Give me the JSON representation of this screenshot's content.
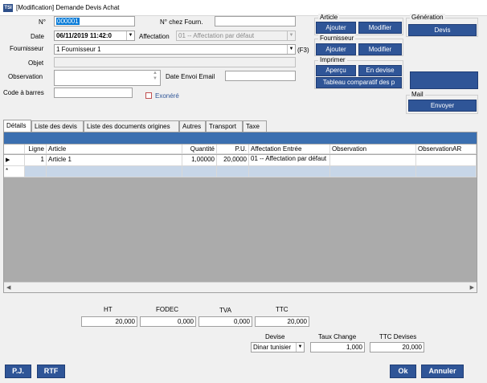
{
  "window": {
    "title": "[Modification] Demande Devis Achat",
    "app_icon_text": "TSI"
  },
  "form": {
    "no_label": "N°",
    "no_value": "000001",
    "no_fourn_label": "N° chez Fourn.",
    "no_fourn_value": "",
    "date_label": "Date",
    "date_value": "06/11/2019 11:42:0",
    "affectation_label": "Affectation",
    "affectation_value": "01 -- Affectation par défaut",
    "fournisseur_label": "Fournisseur",
    "fournisseur_value": "1 Fournisseur 1",
    "fournisseur_shortcut": "(F3)",
    "objet_label": "Objet",
    "objet_value": "",
    "observation_label": "Observation",
    "observation_value": "",
    "date_envoi_label": "Date Envoi Email",
    "date_envoi_value": "",
    "code_barres_label": "Code à barres",
    "code_barres_value": "",
    "exonere_label": "Exonéré"
  },
  "groups": {
    "article": {
      "label": "Article",
      "ajouter": "Ajouter",
      "modifier": "Modifier"
    },
    "fournisseur": {
      "label": "Fournisseur",
      "ajouter": "Ajouter",
      "modifier": "Modifier"
    },
    "imprimer": {
      "label": "Imprimer",
      "apercu": "Aperçu",
      "en_devise": "En devise",
      "tableau": "Tableau comparatif des p"
    },
    "generation": {
      "label": "Génération",
      "devis": "Devis"
    },
    "mail": {
      "label": "Mail",
      "envoyer": "Envoyer"
    }
  },
  "tabs": [
    "Détails",
    "Liste des devis",
    "Liste des documents origines",
    "Autres",
    "Transport",
    "Taxe"
  ],
  "grid": {
    "columns": [
      "Ligne",
      "Article",
      "Quantité",
      "P.U.",
      "Affectation Entrée",
      "Observation",
      "ObservationAR"
    ],
    "rows": [
      {
        "ligne": "1",
        "article": "Article 1",
        "quantite": "1,00000",
        "pu": "20,0000",
        "affectation": "01 -- Affectation par défaut",
        "observation": "",
        "observation_ar": ""
      }
    ],
    "new_row_marker": "*"
  },
  "totals": {
    "ht_label": "HT",
    "ht_value": "20,000",
    "fodec_label": "FODEC",
    "fodec_value": "0,000",
    "tva_label": "TVA",
    "tva_value": "0,000",
    "ttc_label": "TTC",
    "ttc_value": "20,000",
    "devise_label": "Devise",
    "devise_value": "Dinar tunisier",
    "taux_label": "Taux Change",
    "taux_value": "1,000",
    "ttc_devises_label": "TTC Devises",
    "ttc_devises_value": "20,000"
  },
  "footer": {
    "pj": "P.J.",
    "rtf": "RTF",
    "ok": "Ok",
    "annuler": "Annuler"
  }
}
